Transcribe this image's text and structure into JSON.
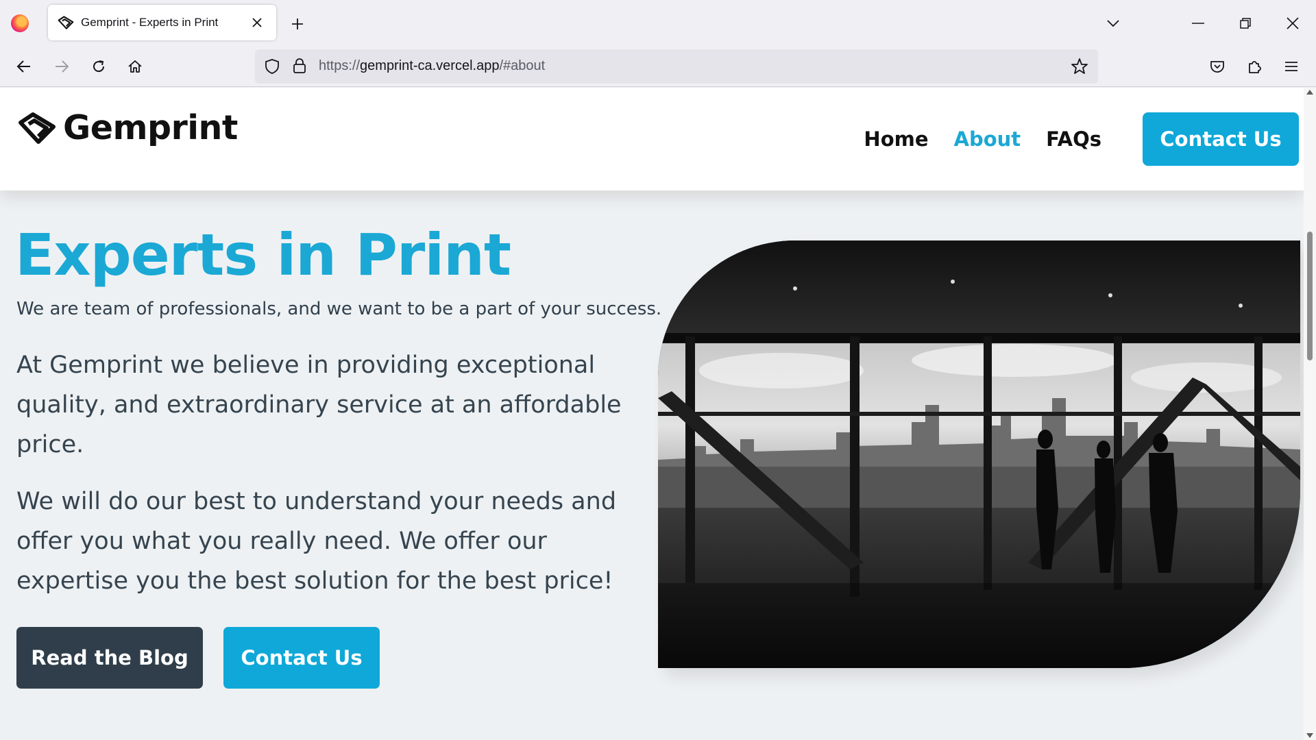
{
  "browser": {
    "tab_title": "Gemprint - Experts in Print",
    "url_prefix": "https://",
    "url_domain": "gemprint-ca.vercel.app",
    "url_path": "/#about"
  },
  "site": {
    "brand": "Gemprint",
    "nav": {
      "home": "Home",
      "about": "About",
      "faqs": "FAQs",
      "contact": "Contact Us"
    },
    "active_nav": "About"
  },
  "hero": {
    "title": "Experts in Print",
    "subtitle": "We are team of professionals, and we want to be a part of your success.",
    "paragraph1": "At Gemprint we believe in providing exceptional quality, and extraordinary service at an affordable price.",
    "paragraph2": "We will do our best to understand your needs and offer you what you really need. We offer our expertise you the best solution for the best price!",
    "btn_blog": "Read the Blog",
    "btn_contact": "Contact Us"
  },
  "colors": {
    "accent": "#1ba8d5",
    "button_blue": "#0fa8d8",
    "button_dark": "#2f3e4a",
    "page_bg": "#eef1f3"
  },
  "icons": {
    "browser_logo": "firefox-icon",
    "favicon": "gemprint-logo-icon",
    "back": "back-arrow-icon",
    "forward": "forward-arrow-icon",
    "reload": "reload-icon",
    "home": "home-icon",
    "shield": "shield-icon",
    "lock": "lock-icon",
    "bookmark": "star-icon",
    "pocket": "pocket-icon",
    "extensions": "puzzle-icon",
    "menu": "hamburger-menu-icon"
  }
}
